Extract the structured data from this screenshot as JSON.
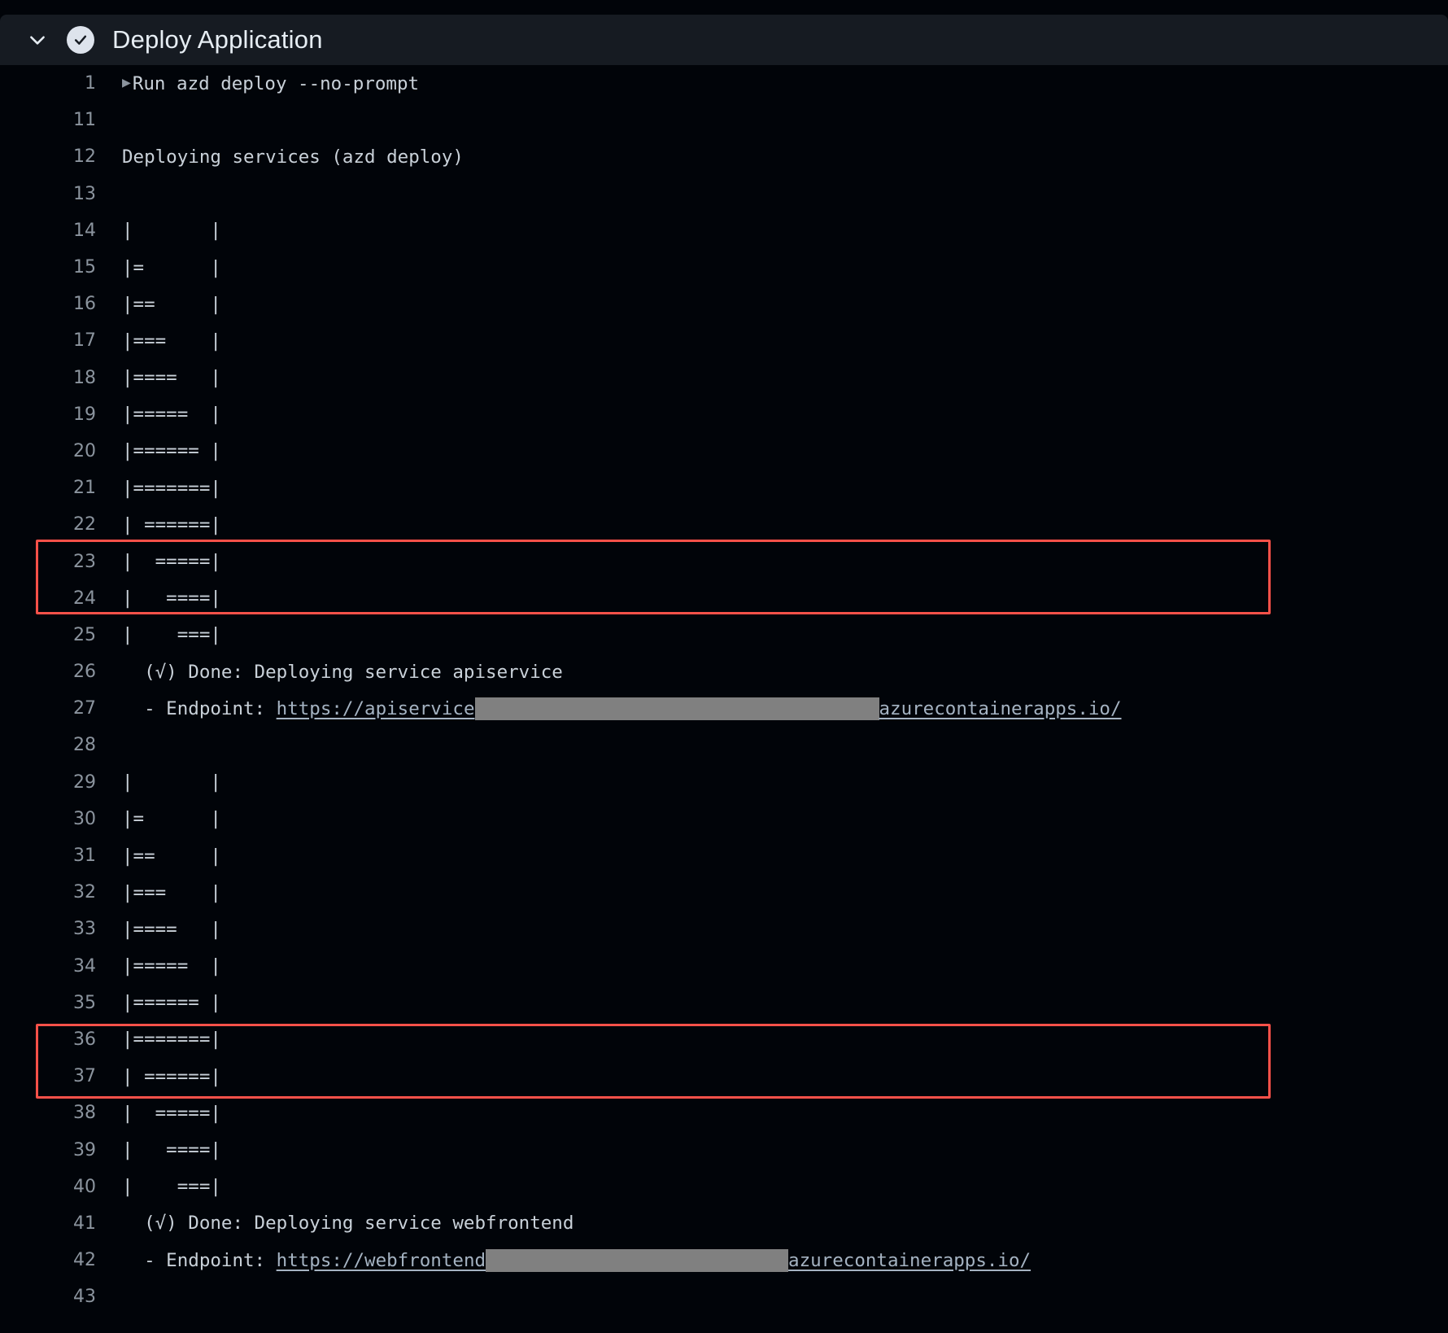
{
  "header": {
    "title": "Deploy Application",
    "collapse_icon": "chevron-down-icon",
    "status_icon": "check-circle-icon",
    "status": "success"
  },
  "colors": {
    "background": "#010409",
    "header_background": "#161b22",
    "text": "#c9d1d9",
    "line_number": "#8b949e",
    "link": "#a5b3c2",
    "highlight_border": "#f85149",
    "redaction": "#808080",
    "status_badge": "#dde3ec"
  },
  "log": {
    "lines": [
      {
        "n": "1",
        "caret": "▶",
        "text": "Run azd deploy --no-prompt"
      },
      {
        "n": "11",
        "text": ""
      },
      {
        "n": "12",
        "text": "Deploying services (azd deploy)"
      },
      {
        "n": "13",
        "text": ""
      },
      {
        "n": "14",
        "text": "|       |"
      },
      {
        "n": "15",
        "text": "|=      |"
      },
      {
        "n": "16",
        "text": "|==     |"
      },
      {
        "n": "17",
        "text": "|===    |"
      },
      {
        "n": "18",
        "text": "|====   |"
      },
      {
        "n": "19",
        "text": "|=====  |"
      },
      {
        "n": "20",
        "text": "|====== |"
      },
      {
        "n": "21",
        "text": "|=======|"
      },
      {
        "n": "22",
        "text": "| ======|"
      },
      {
        "n": "23",
        "text": "|  =====|"
      },
      {
        "n": "24",
        "text": "|   ====|"
      },
      {
        "n": "25",
        "text": "|    ===|"
      },
      {
        "n": "26",
        "text": "  (√) Done: Deploying service apiservice",
        "highlight": true
      },
      {
        "n": "27",
        "type": "endpoint",
        "prefix": "  - Endpoint: ",
        "link_before": "https://apiservice",
        "redaction": "w1",
        "link_after": "azurecontainerapps.io/",
        "highlight": true
      },
      {
        "n": "28",
        "text": ""
      },
      {
        "n": "29",
        "text": "|       |"
      },
      {
        "n": "30",
        "text": "|=      |"
      },
      {
        "n": "31",
        "text": "|==     |"
      },
      {
        "n": "32",
        "text": "|===    |"
      },
      {
        "n": "33",
        "text": "|====   |"
      },
      {
        "n": "34",
        "text": "|=====  |"
      },
      {
        "n": "35",
        "text": "|====== |"
      },
      {
        "n": "36",
        "text": "|=======|"
      },
      {
        "n": "37",
        "text": "| ======|"
      },
      {
        "n": "38",
        "text": "|  =====|"
      },
      {
        "n": "39",
        "text": "|   ====|"
      },
      {
        "n": "40",
        "text": "|    ===|"
      },
      {
        "n": "41",
        "text": "  (√) Done: Deploying service webfrontend",
        "highlight": true
      },
      {
        "n": "42",
        "type": "endpoint",
        "prefix": "  - Endpoint: ",
        "link_before": "https://webfrontend",
        "redaction": "w2",
        "link_after": "azurecontainerapps.io/",
        "highlight": true
      },
      {
        "n": "43",
        "text": ""
      }
    ]
  }
}
